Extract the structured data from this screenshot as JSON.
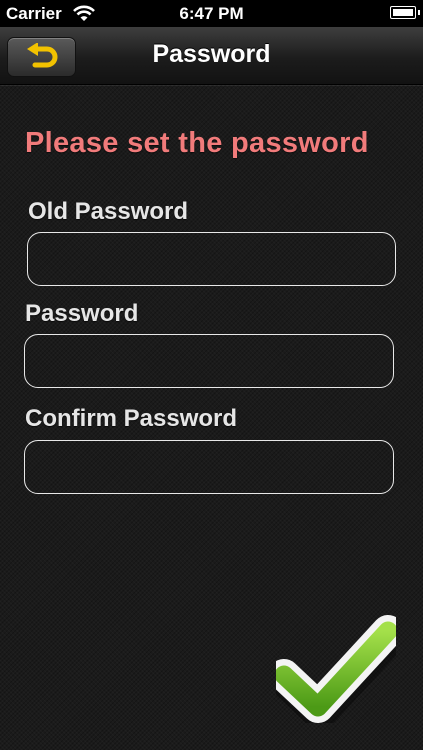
{
  "status_bar": {
    "carrier": "Carrier",
    "time": "6:47 PM",
    "wifi_icon": "wifi-icon",
    "battery_icon": "battery-icon"
  },
  "nav": {
    "title": "Password",
    "back_icon": "return-arrow-icon",
    "back_icon_color": "#f2c200"
  },
  "form": {
    "headline": "Please set the password",
    "headline_color": "#f17b7b",
    "old_password_label": "Old Password",
    "old_password_value": "",
    "password_label": "Password",
    "password_value": "",
    "confirm_label": "Confirm Password",
    "confirm_value": ""
  },
  "confirm": {
    "icon": "checkmark-icon",
    "color": "#6bb82a"
  }
}
